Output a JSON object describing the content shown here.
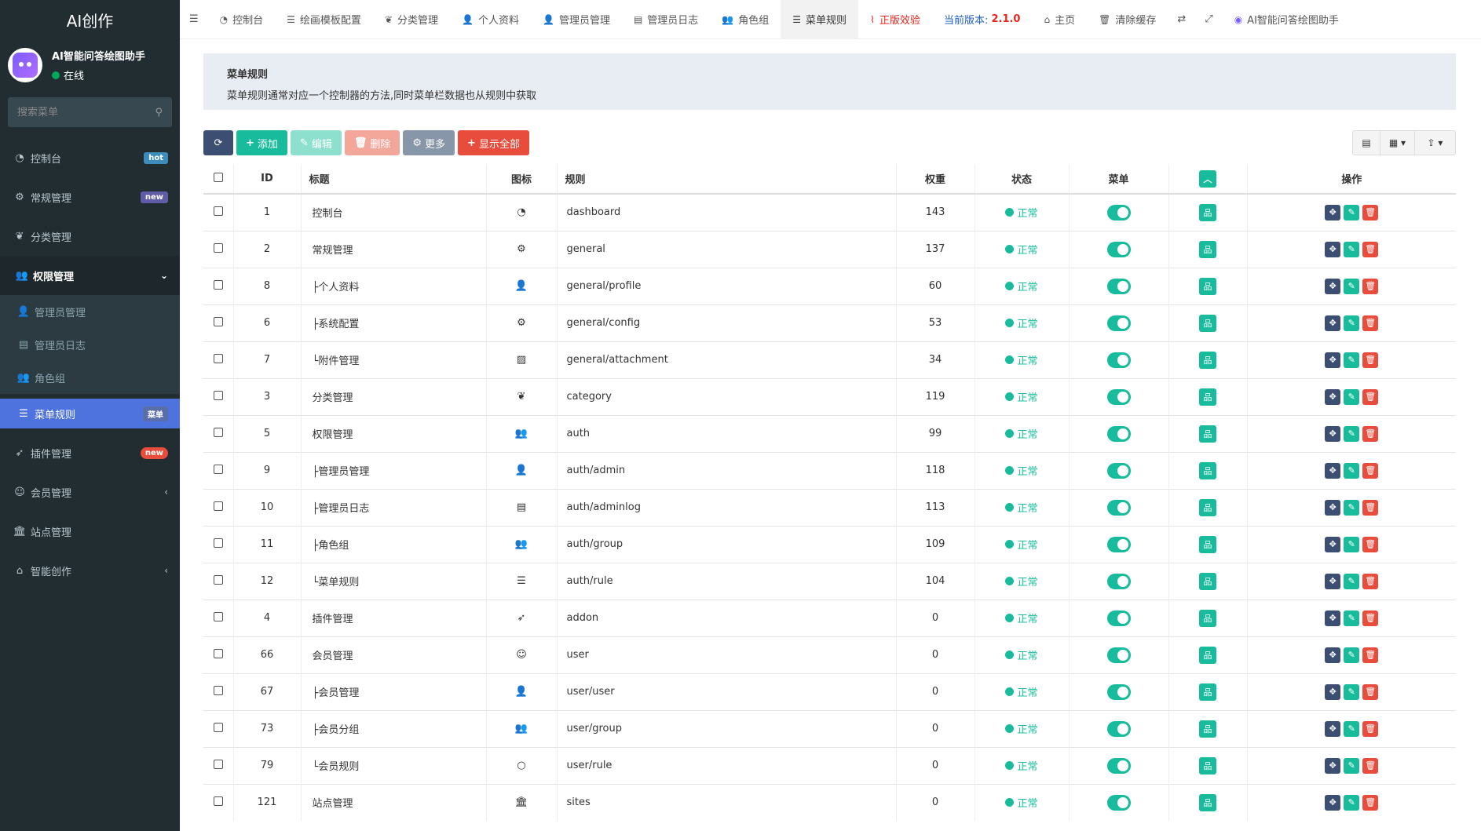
{
  "sidebar": {
    "logo": "AI创作",
    "user_name": "AI智能问答绘图助手",
    "user_status": "在线",
    "search_placeholder": "搜索菜单",
    "items": [
      {
        "label": "控制台",
        "icon": "dashboard-icon",
        "glyph": "◔",
        "badge": "hot",
        "badge_color": "#3c8dbc"
      },
      {
        "label": "常规管理",
        "icon": "cogs-icon",
        "glyph": "⚙",
        "badge": "new",
        "badge_color": "#605ca8"
      },
      {
        "label": "分类管理",
        "icon": "leaf-icon",
        "glyph": "❦"
      },
      {
        "label": "权限管理",
        "icon": "group-icon",
        "glyph": "👥",
        "chevron": "⌄"
      },
      {
        "label": "管理员管理",
        "icon": "user-icon",
        "glyph": "👤"
      },
      {
        "label": "管理员日志",
        "icon": "list-alt-icon",
        "glyph": "▤"
      },
      {
        "label": "角色组",
        "icon": "group-icon",
        "glyph": "👥"
      },
      {
        "label": "菜单规则",
        "icon": "bars-icon",
        "glyph": "☰",
        "badge": "菜单",
        "badge_color": "#5a6fa8"
      },
      {
        "label": "插件管理",
        "icon": "rocket-icon",
        "glyph": "➶",
        "badge": "new",
        "badge_color": "#e74c3c"
      },
      {
        "label": "会员管理",
        "icon": "user-circle-icon",
        "glyph": "☺",
        "chevron": "‹"
      },
      {
        "label": "站点管理",
        "icon": "bank-icon",
        "glyph": "🏛"
      },
      {
        "label": "智能创作",
        "icon": "home-icon",
        "glyph": "⌂",
        "chevron": "‹"
      }
    ]
  },
  "topnav": {
    "items": [
      {
        "label": "控制台",
        "icon": "dashboard-icon",
        "glyph": "◔"
      },
      {
        "label": "绘画模板配置",
        "icon": "list-icon",
        "glyph": "☰"
      },
      {
        "label": "分类管理",
        "icon": "leaf-icon",
        "glyph": "❦"
      },
      {
        "label": "个人资料",
        "icon": "user-icon",
        "glyph": "👤"
      },
      {
        "label": "管理员管理",
        "icon": "user-icon",
        "glyph": "👤"
      },
      {
        "label": "管理员日志",
        "icon": "list-alt-icon",
        "glyph": "▤"
      },
      {
        "label": "角色组",
        "icon": "group-icon",
        "glyph": "👥"
      },
      {
        "label": "菜单规则",
        "icon": "bars-icon",
        "glyph": "☰"
      }
    ],
    "genuine": "正版效验",
    "version_label": "当前版本:",
    "version": "2.1.0",
    "home": "主页",
    "clear_cache": "清除缓存",
    "assistant": "AI智能问答绘图助手"
  },
  "header": {
    "title": "菜单规则",
    "desc": "菜单规则通常对应一个控制器的方法,同时菜单栏数据也从规则中获取"
  },
  "toolbar": {
    "add": "添加",
    "edit": "编辑",
    "delete": "删除",
    "more": "更多",
    "show_all": "显示全部"
  },
  "table": {
    "headers": {
      "id": "ID",
      "title": "标题",
      "icon": "图标",
      "rule": "规则",
      "weigh": "权重",
      "status": "状态",
      "menu": "菜单",
      "ops": "操作"
    },
    "status_text": "正常",
    "rows": [
      {
        "id": "1",
        "title": "控制台",
        "icon": "dashboard-icon",
        "glyph": "◔",
        "rule": "dashboard",
        "weigh": "143"
      },
      {
        "id": "2",
        "title": "常规管理",
        "icon": "cogs-icon",
        "glyph": "⚙",
        "rule": "general",
        "weigh": "137"
      },
      {
        "id": "8",
        "title": "├个人资料",
        "icon": "user-icon",
        "glyph": "👤",
        "rule": "general/profile",
        "weigh": "60"
      },
      {
        "id": "6",
        "title": "├系统配置",
        "icon": "cog-icon",
        "glyph": "⚙",
        "rule": "general/config",
        "weigh": "53"
      },
      {
        "id": "7",
        "title": "└附件管理",
        "icon": "file-image-icon",
        "glyph": "▨",
        "rule": "general/attachment",
        "weigh": "34"
      },
      {
        "id": "3",
        "title": "分类管理",
        "icon": "leaf-icon",
        "glyph": "❦",
        "rule": "category",
        "weigh": "119"
      },
      {
        "id": "5",
        "title": "权限管理",
        "icon": "group-icon",
        "glyph": "👥",
        "rule": "auth",
        "weigh": "99"
      },
      {
        "id": "9",
        "title": "├管理员管理",
        "icon": "user-icon",
        "glyph": "👤",
        "rule": "auth/admin",
        "weigh": "118"
      },
      {
        "id": "10",
        "title": "├管理员日志",
        "icon": "list-alt-icon",
        "glyph": "▤",
        "rule": "auth/adminlog",
        "weigh": "113"
      },
      {
        "id": "11",
        "title": "├角色组",
        "icon": "group-icon",
        "glyph": "👥",
        "rule": "auth/group",
        "weigh": "109"
      },
      {
        "id": "12",
        "title": "└菜单规则",
        "icon": "bars-icon",
        "glyph": "☰",
        "rule": "auth/rule",
        "weigh": "104"
      },
      {
        "id": "4",
        "title": "插件管理",
        "icon": "rocket-icon",
        "glyph": "➶",
        "rule": "addon",
        "weigh": "0"
      },
      {
        "id": "66",
        "title": "会员管理",
        "icon": "user-circle-icon",
        "glyph": "☺",
        "rule": "user",
        "weigh": "0"
      },
      {
        "id": "67",
        "title": "├会员管理",
        "icon": "user-icon",
        "glyph": "👤",
        "rule": "user/user",
        "weigh": "0"
      },
      {
        "id": "73",
        "title": "├会员分组",
        "icon": "group-icon",
        "glyph": "👥",
        "rule": "user/group",
        "weigh": "0"
      },
      {
        "id": "79",
        "title": "└会员规则",
        "icon": "circle-o-icon",
        "glyph": "○",
        "rule": "user/rule",
        "weigh": "0"
      },
      {
        "id": "121",
        "title": "站点管理",
        "icon": "bank-icon",
        "glyph": "🏛",
        "rule": "sites",
        "weigh": "0"
      }
    ]
  }
}
